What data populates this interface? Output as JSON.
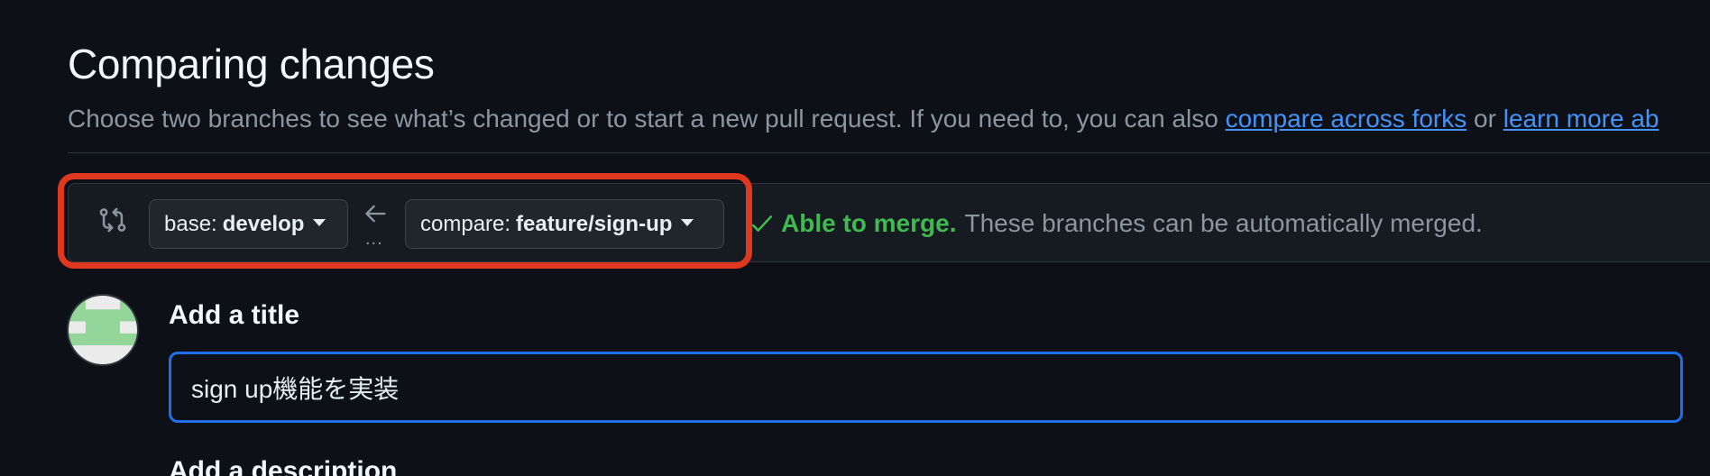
{
  "header": {
    "title": "Comparing changes",
    "subtitle_text": "Choose two branches to see what’s changed or to start a new pull request. If you need to, you can also ",
    "link_forks": "compare across forks",
    "subtitle_or": " or ",
    "link_learn": "learn more ab"
  },
  "range": {
    "base_prefix": "base:",
    "base_branch": "develop",
    "compare_prefix": "compare:",
    "compare_branch": "feature/sign-up",
    "dots": "...",
    "merge_ok": "Able to merge.",
    "merge_msg": "These branches can be automatically merged."
  },
  "form": {
    "title_label": "Add a title",
    "title_value": "sign up機能を実装",
    "description_label": "Add a description"
  },
  "colors": {
    "accent": "#1f6feb",
    "link": "#4493f8",
    "success": "#3fb950",
    "highlight": "#e0371f",
    "background": "#0d1117"
  },
  "icons": [
    "git-compare-icon",
    "caret-down-icon",
    "arrow-left-icon",
    "check-icon"
  ]
}
